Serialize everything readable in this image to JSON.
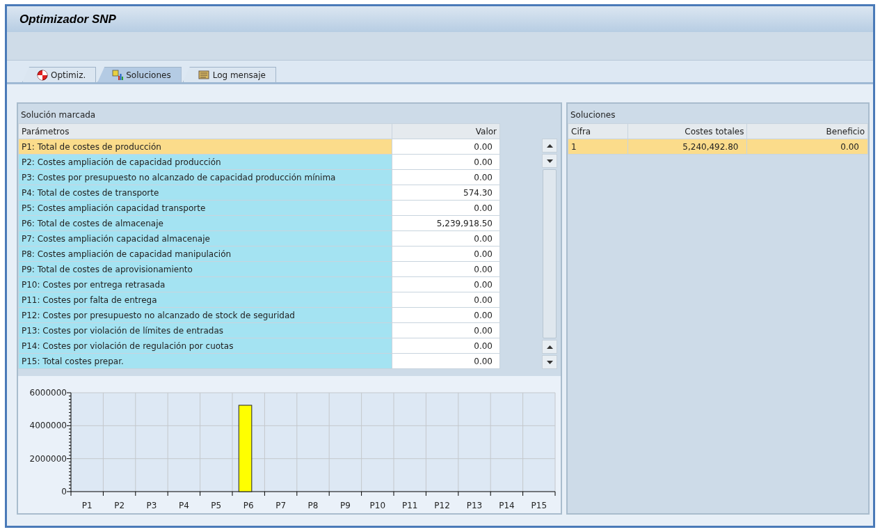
{
  "window": {
    "title": "Optimizador SNP"
  },
  "tabs": [
    {
      "label": "Optimiz.",
      "selected": false
    },
    {
      "label": "Soluciones",
      "selected": true
    },
    {
      "label": "Log mensaje",
      "selected": false
    }
  ],
  "marked_solution": {
    "title": "Solución marcada",
    "columns": [
      "Parámetros",
      "Valor"
    ],
    "rows": [
      {
        "parameter": "P1: Total de costes de producción",
        "value": "0.00",
        "selected": true
      },
      {
        "parameter": "P2: Costes ampliación de capacidad producción",
        "value": "0.00",
        "selected": false
      },
      {
        "parameter": "P3: Costes por presupuesto no alcanzado de capacidad producción mínima",
        "value": "0.00",
        "selected": false
      },
      {
        "parameter": "P4: Total de costes de transporte",
        "value": "574.30",
        "selected": false
      },
      {
        "parameter": "P5: Costes ampliación capacidad transporte",
        "value": "0.00",
        "selected": false
      },
      {
        "parameter": "P6: Total de costes de almacenaje",
        "value": "5,239,918.50",
        "selected": false
      },
      {
        "parameter": "P7: Costes ampliación capacidad almacenaje",
        "value": "0.00",
        "selected": false
      },
      {
        "parameter": "P8: Costes ampliación de capacidad manipulación",
        "value": "0.00",
        "selected": false
      },
      {
        "parameter": "P9: Total de costes de aprovisionamiento",
        "value": "0.00",
        "selected": false
      },
      {
        "parameter": "P10: Costes por entrega retrasada",
        "value": "0.00",
        "selected": false
      },
      {
        "parameter": "P11: Costes por falta de entrega",
        "value": "0.00",
        "selected": false
      },
      {
        "parameter": "P12: Costes por presupuesto no alcanzado de stock de seguridad",
        "value": "0.00",
        "selected": false
      },
      {
        "parameter": "P13: Costes por violación de límites de entradas",
        "value": "0.00",
        "selected": false
      },
      {
        "parameter": "P14: Costes por violación de regulación por cuotas",
        "value": "0.00",
        "selected": false
      },
      {
        "parameter": "P15: Total costes prepar.",
        "value": "0.00",
        "selected": false
      }
    ],
    "chart_data": {
      "type": "bar",
      "categories": [
        "P1",
        "P2",
        "P3",
        "P4",
        "P5",
        "P6",
        "P7",
        "P8",
        "P9",
        "P10",
        "P11",
        "P12",
        "P13",
        "P14",
        "P15"
      ],
      "series": [
        {
          "color": "#ffff00",
          "values": [
            0,
            0,
            0,
            0,
            0,
            5240000,
            0,
            0,
            0,
            0,
            0,
            0,
            0,
            0,
            0
          ]
        }
      ],
      "ylim": [
        0,
        6000000
      ],
      "yticks": [
        0,
        2000000,
        4000000,
        6000000
      ]
    }
  },
  "solutions": {
    "title": "Soluciones",
    "columns": [
      "Cifra",
      "Costes totales",
      "Beneficio"
    ],
    "rows": [
      {
        "cells": [
          "1",
          "5,240,492.80",
          "0.00"
        ],
        "selected": true
      }
    ]
  }
}
